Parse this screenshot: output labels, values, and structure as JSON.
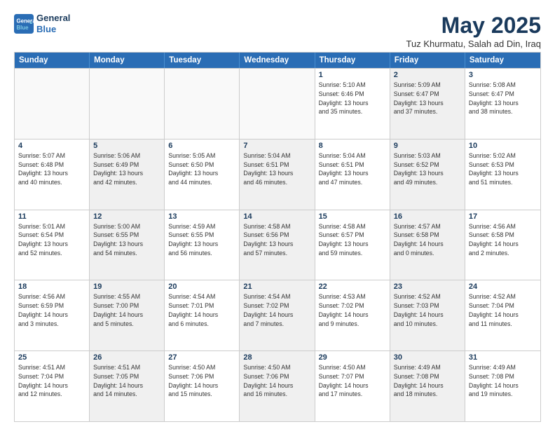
{
  "header": {
    "logo_line1": "General",
    "logo_line2": "Blue",
    "title": "May 2025",
    "subtitle": "Tuz Khurmatu, Salah ad Din, Iraq"
  },
  "days_of_week": [
    "Sunday",
    "Monday",
    "Tuesday",
    "Wednesday",
    "Thursday",
    "Friday",
    "Saturday"
  ],
  "weeks": [
    [
      {
        "day": "",
        "info": "",
        "empty": true
      },
      {
        "day": "",
        "info": "",
        "empty": true
      },
      {
        "day": "",
        "info": "",
        "empty": true
      },
      {
        "day": "",
        "info": "",
        "empty": true
      },
      {
        "day": "1",
        "info": "Sunrise: 5:10 AM\nSunset: 6:46 PM\nDaylight: 13 hours\nand 35 minutes."
      },
      {
        "day": "2",
        "info": "Sunrise: 5:09 AM\nSunset: 6:47 PM\nDaylight: 13 hours\nand 37 minutes.",
        "shaded": true
      },
      {
        "day": "3",
        "info": "Sunrise: 5:08 AM\nSunset: 6:47 PM\nDaylight: 13 hours\nand 38 minutes."
      }
    ],
    [
      {
        "day": "4",
        "info": "Sunrise: 5:07 AM\nSunset: 6:48 PM\nDaylight: 13 hours\nand 40 minutes."
      },
      {
        "day": "5",
        "info": "Sunrise: 5:06 AM\nSunset: 6:49 PM\nDaylight: 13 hours\nand 42 minutes.",
        "shaded": true
      },
      {
        "day": "6",
        "info": "Sunrise: 5:05 AM\nSunset: 6:50 PM\nDaylight: 13 hours\nand 44 minutes."
      },
      {
        "day": "7",
        "info": "Sunrise: 5:04 AM\nSunset: 6:51 PM\nDaylight: 13 hours\nand 46 minutes.",
        "shaded": true
      },
      {
        "day": "8",
        "info": "Sunrise: 5:04 AM\nSunset: 6:51 PM\nDaylight: 13 hours\nand 47 minutes."
      },
      {
        "day": "9",
        "info": "Sunrise: 5:03 AM\nSunset: 6:52 PM\nDaylight: 13 hours\nand 49 minutes.",
        "shaded": true
      },
      {
        "day": "10",
        "info": "Sunrise: 5:02 AM\nSunset: 6:53 PM\nDaylight: 13 hours\nand 51 minutes."
      }
    ],
    [
      {
        "day": "11",
        "info": "Sunrise: 5:01 AM\nSunset: 6:54 PM\nDaylight: 13 hours\nand 52 minutes."
      },
      {
        "day": "12",
        "info": "Sunrise: 5:00 AM\nSunset: 6:55 PM\nDaylight: 13 hours\nand 54 minutes.",
        "shaded": true
      },
      {
        "day": "13",
        "info": "Sunrise: 4:59 AM\nSunset: 6:55 PM\nDaylight: 13 hours\nand 56 minutes."
      },
      {
        "day": "14",
        "info": "Sunrise: 4:58 AM\nSunset: 6:56 PM\nDaylight: 13 hours\nand 57 minutes.",
        "shaded": true
      },
      {
        "day": "15",
        "info": "Sunrise: 4:58 AM\nSunset: 6:57 PM\nDaylight: 13 hours\nand 59 minutes."
      },
      {
        "day": "16",
        "info": "Sunrise: 4:57 AM\nSunset: 6:58 PM\nDaylight: 14 hours\nand 0 minutes.",
        "shaded": true
      },
      {
        "day": "17",
        "info": "Sunrise: 4:56 AM\nSunset: 6:58 PM\nDaylight: 14 hours\nand 2 minutes."
      }
    ],
    [
      {
        "day": "18",
        "info": "Sunrise: 4:56 AM\nSunset: 6:59 PM\nDaylight: 14 hours\nand 3 minutes."
      },
      {
        "day": "19",
        "info": "Sunrise: 4:55 AM\nSunset: 7:00 PM\nDaylight: 14 hours\nand 5 minutes.",
        "shaded": true
      },
      {
        "day": "20",
        "info": "Sunrise: 4:54 AM\nSunset: 7:01 PM\nDaylight: 14 hours\nand 6 minutes."
      },
      {
        "day": "21",
        "info": "Sunrise: 4:54 AM\nSunset: 7:02 PM\nDaylight: 14 hours\nand 7 minutes.",
        "shaded": true
      },
      {
        "day": "22",
        "info": "Sunrise: 4:53 AM\nSunset: 7:02 PM\nDaylight: 14 hours\nand 9 minutes."
      },
      {
        "day": "23",
        "info": "Sunrise: 4:52 AM\nSunset: 7:03 PM\nDaylight: 14 hours\nand 10 minutes.",
        "shaded": true
      },
      {
        "day": "24",
        "info": "Sunrise: 4:52 AM\nSunset: 7:04 PM\nDaylight: 14 hours\nand 11 minutes."
      }
    ],
    [
      {
        "day": "25",
        "info": "Sunrise: 4:51 AM\nSunset: 7:04 PM\nDaylight: 14 hours\nand 12 minutes."
      },
      {
        "day": "26",
        "info": "Sunrise: 4:51 AM\nSunset: 7:05 PM\nDaylight: 14 hours\nand 14 minutes.",
        "shaded": true
      },
      {
        "day": "27",
        "info": "Sunrise: 4:50 AM\nSunset: 7:06 PM\nDaylight: 14 hours\nand 15 minutes."
      },
      {
        "day": "28",
        "info": "Sunrise: 4:50 AM\nSunset: 7:06 PM\nDaylight: 14 hours\nand 16 minutes.",
        "shaded": true
      },
      {
        "day": "29",
        "info": "Sunrise: 4:50 AM\nSunset: 7:07 PM\nDaylight: 14 hours\nand 17 minutes."
      },
      {
        "day": "30",
        "info": "Sunrise: 4:49 AM\nSunset: 7:08 PM\nDaylight: 14 hours\nand 18 minutes.",
        "shaded": true
      },
      {
        "day": "31",
        "info": "Sunrise: 4:49 AM\nSunset: 7:08 PM\nDaylight: 14 hours\nand 19 minutes."
      }
    ]
  ]
}
